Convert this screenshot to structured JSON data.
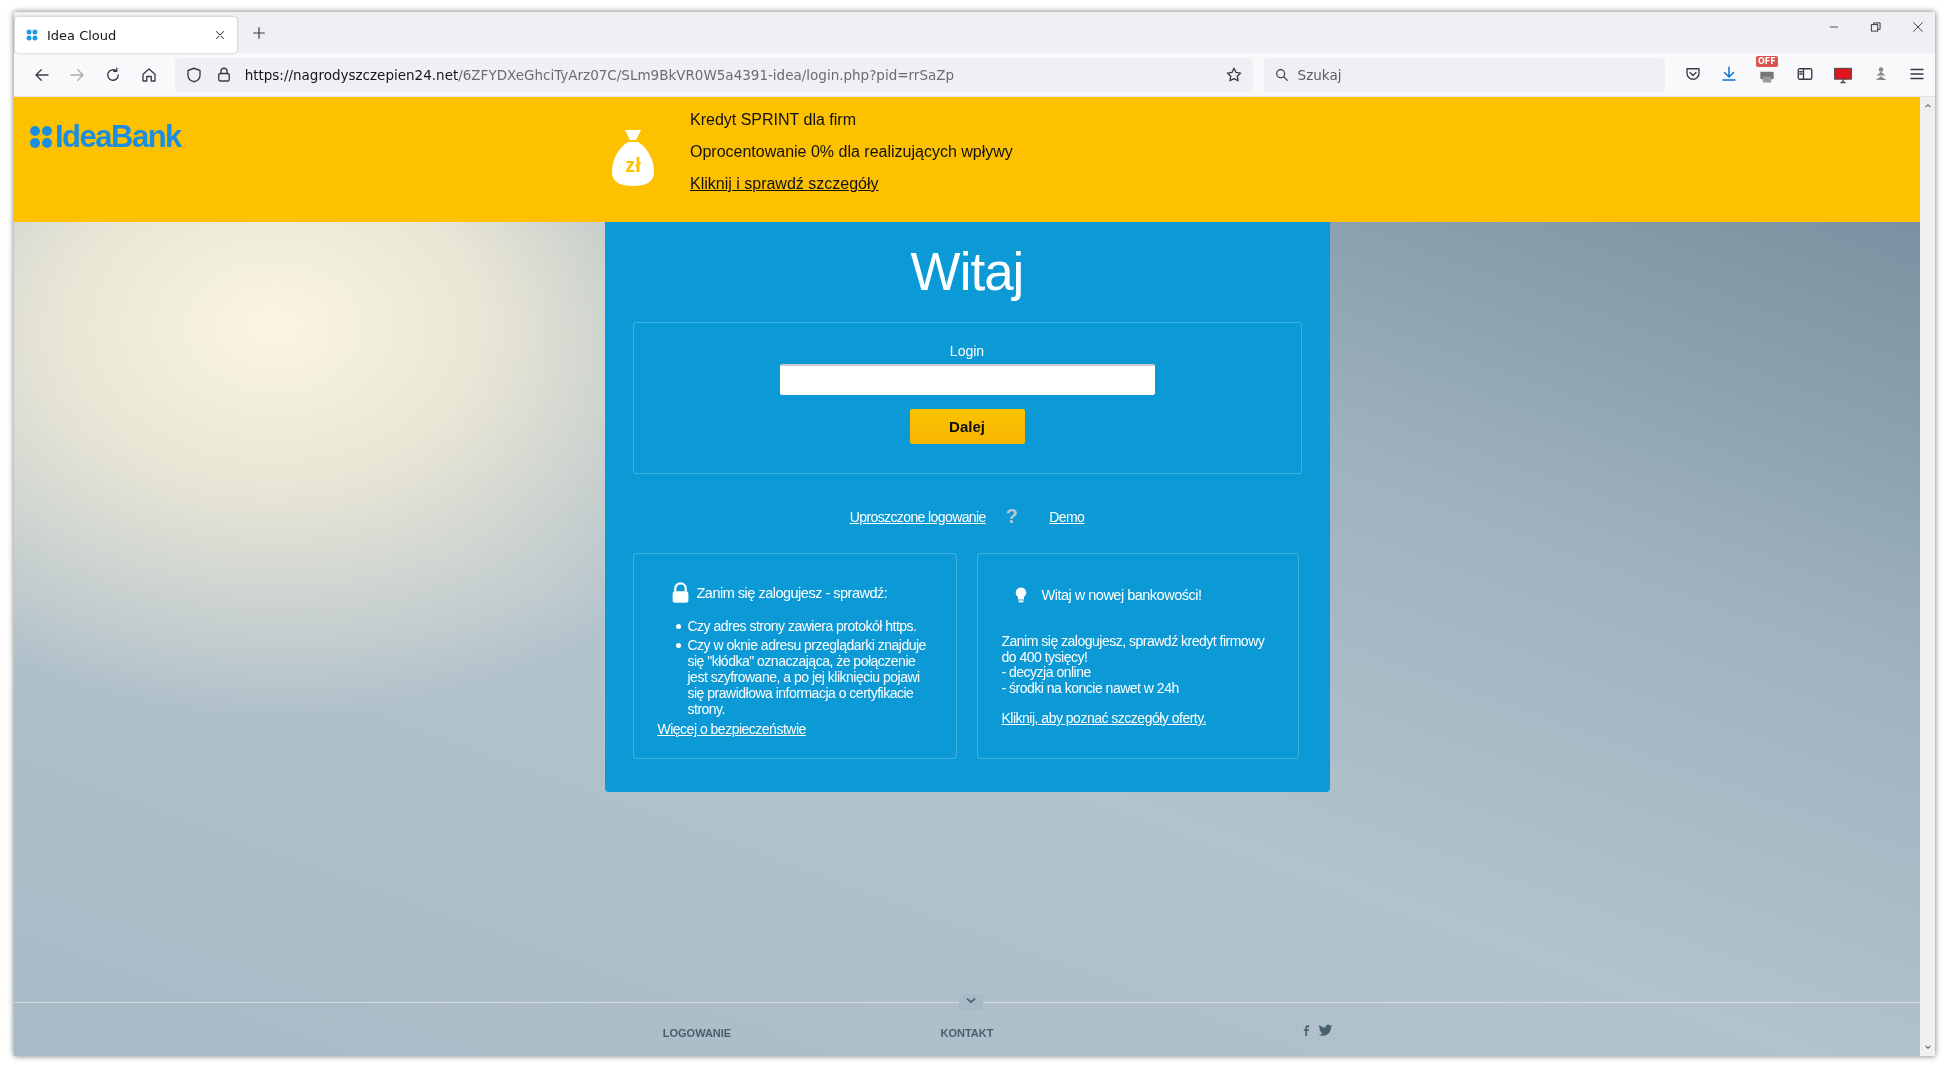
{
  "browser": {
    "tab": {
      "title": "Idea Cloud"
    },
    "url": {
      "host": "https://nagrodyszczepien24.net",
      "path": "/6ZFYDXeGhciTyArz07C/SLm9BkVR0W5a4391-idea/login.php?pid=rrSaZp"
    },
    "search": {
      "placeholder": "Szukaj"
    },
    "extension_badge": "OFF"
  },
  "header": {
    "logo": "IdeaBank",
    "promo": {
      "currency": "zł",
      "lines": [
        "Kredyt SPRINT dla firm",
        "Oprocentowanie 0% dla realizujących wpływy"
      ],
      "link": "Kliknij i sprawdź szczegóły"
    }
  },
  "login": {
    "title": "Witaj",
    "field_label": "Login",
    "submit": "Dalej",
    "simple_login": "Uproszczone logowanie",
    "help": "?",
    "demo": "Demo"
  },
  "info_boxes": [
    {
      "kind": "security",
      "title": "Zanim się zalogujesz - sprawdź:",
      "bullets": [
        "Czy adres strony zawiera protokół https.",
        "Czy w oknie adresu przeglądarki znajduje się \"kłódka\" oznaczająca, że połączenie jest szyfrowane, a po jej kliknięciu pojawi się prawidłowa informacja o certyfikacie strony."
      ],
      "link": "Więcej o bezpieczeństwie"
    },
    {
      "kind": "tip",
      "title": "Witaj w nowej bankowości!",
      "lines": [
        "Zanim się zalogujesz, sprawdź kredyt firmowy do 400 tysięcy!",
        "- decyzja online",
        "- środki na koncie nawet w 24h"
      ],
      "link": "Kliknij, aby poznać szczegóły oferty."
    }
  ],
  "footer": {
    "links": [
      "LOGOWANIE",
      "KONTAKT"
    ]
  }
}
